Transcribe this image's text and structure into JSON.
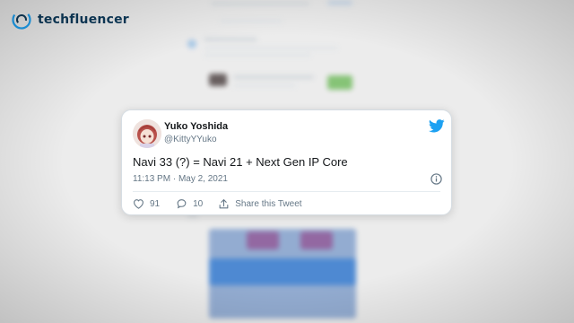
{
  "brand": {
    "name": "techfluencer",
    "accent": "#1da1f2"
  },
  "tweet": {
    "author_name": "Yuko Yoshida",
    "author_handle": "@KittyYYuko",
    "text": "Navi 33 (?) = Navi 21 + Next Gen IP Core",
    "timestamp": "11:13 PM · May 2, 2021",
    "like_count": "91",
    "reply_count": "10",
    "share_label": "Share this Tweet"
  },
  "icons": {
    "logo": "techfluencer-logo-icon",
    "brand": "twitter-bird-icon",
    "info": "info-icon",
    "like": "heart-icon",
    "reply": "reply-icon",
    "share": "share-icon"
  }
}
